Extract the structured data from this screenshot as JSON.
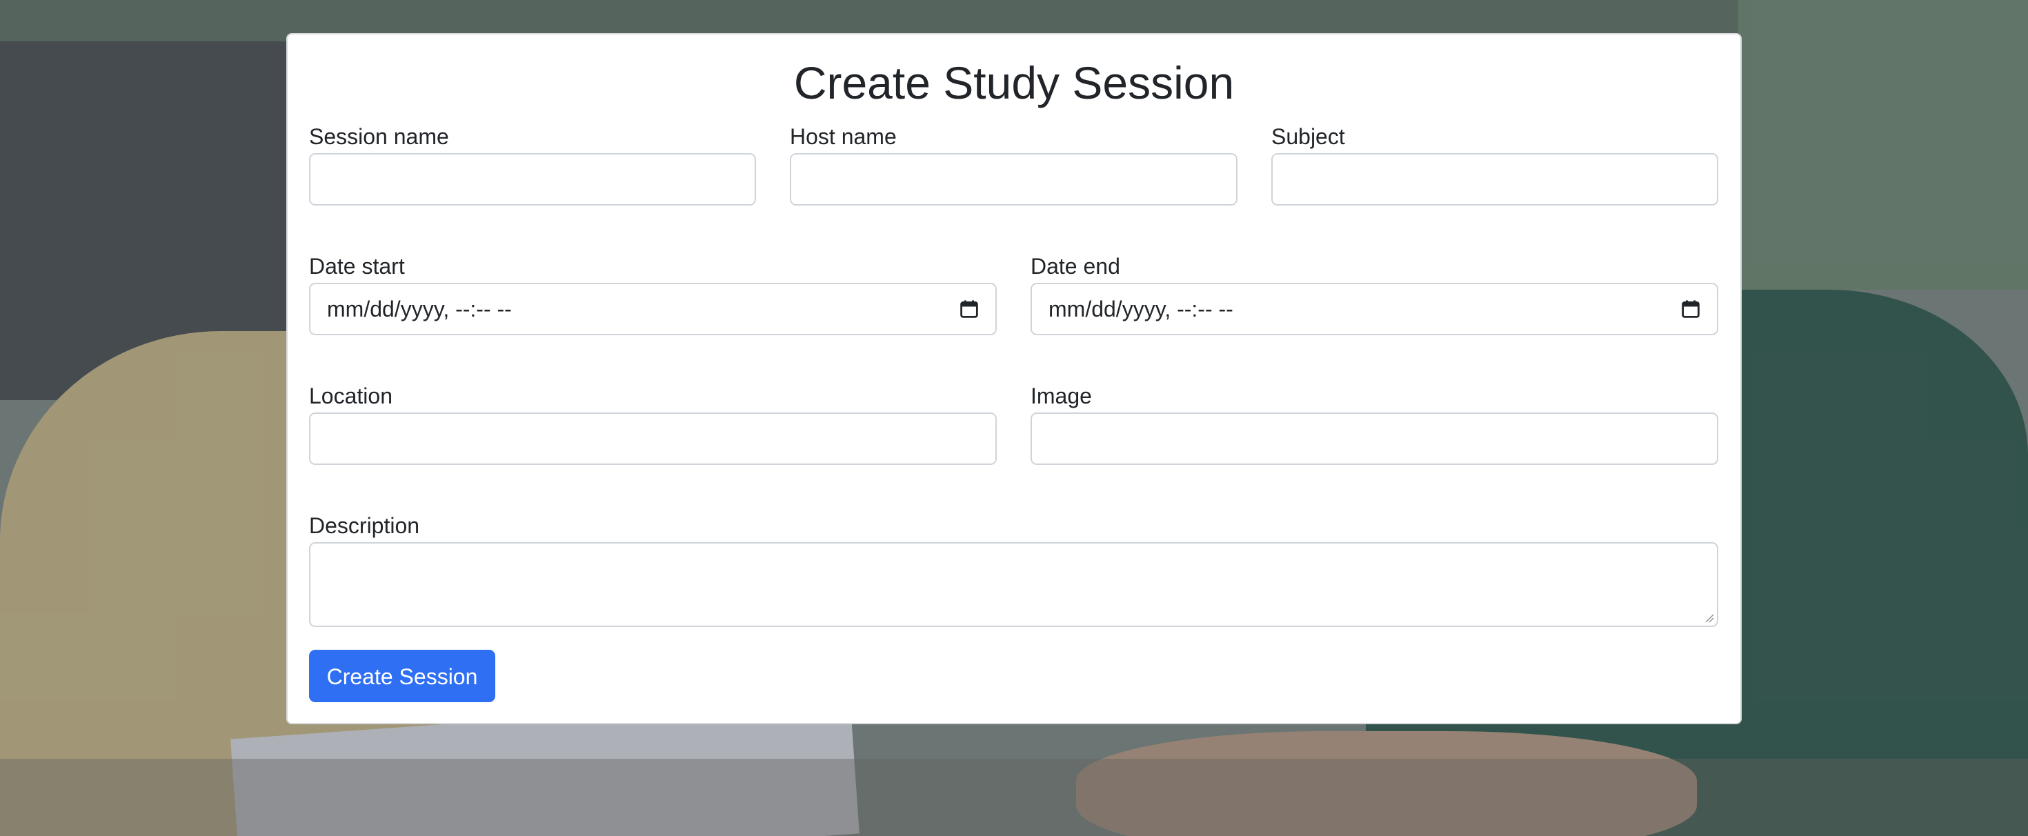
{
  "page": {
    "title": "Create Study Session"
  },
  "form": {
    "session_name": {
      "label": "Session name",
      "value": "",
      "placeholder": ""
    },
    "host_name": {
      "label": "Host name",
      "value": "",
      "placeholder": ""
    },
    "subject": {
      "label": "Subject",
      "value": "",
      "placeholder": ""
    },
    "date_start": {
      "label": "Date start",
      "display": "mm/dd/yyyy, --:-- --"
    },
    "date_end": {
      "label": "Date end",
      "display": "mm/dd/yyyy, --:-- --"
    },
    "location": {
      "label": "Location",
      "value": "",
      "placeholder": ""
    },
    "image": {
      "label": "Image",
      "value": "",
      "placeholder": ""
    },
    "description": {
      "label": "Description",
      "value": "",
      "placeholder": ""
    },
    "submit_label": "Create Session"
  },
  "icons": {
    "calendar": "calendar-icon"
  },
  "colors": {
    "primary_button": "#2f6ff3",
    "card_background": "#ffffff",
    "input_border": "#ced4da",
    "text": "#212529"
  }
}
